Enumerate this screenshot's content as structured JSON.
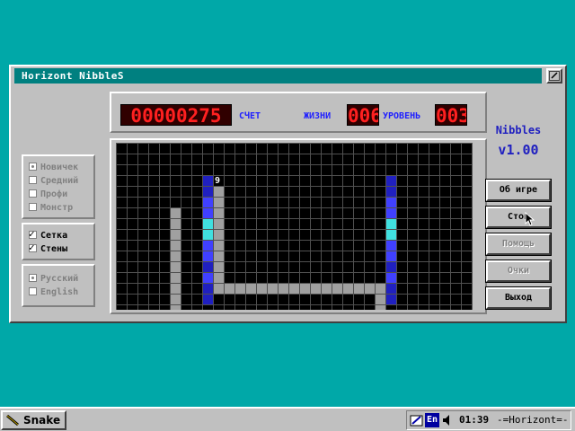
{
  "window": {
    "title": "Horizont NibbleS"
  },
  "options": {
    "difficulty": [
      {
        "label": "Новичек",
        "selected": true
      },
      {
        "label": "Средний",
        "selected": false
      },
      {
        "label": "Профи",
        "selected": false
      },
      {
        "label": "Монстр",
        "selected": false
      }
    ],
    "toggles": [
      {
        "label": "Сетка",
        "checked": true
      },
      {
        "label": "Стены",
        "checked": true
      }
    ],
    "language": [
      {
        "label": "Русский",
        "selected": true
      },
      {
        "label": "English",
        "selected": false
      }
    ]
  },
  "scoreboard": {
    "score": "00000275",
    "score_label": "СЧЕТ",
    "lives_label": "ЖИЗНИ",
    "lives": "006",
    "level_label": "УРОВЕНЬ",
    "level": "003"
  },
  "board": {
    "cols": 33,
    "rows": 23,
    "grid_visible": true,
    "food_number": "9",
    "food_cell": [
      8,
      3
    ],
    "walls": [
      [
        [
          8,
          3
        ],
        [
          8,
          14
        ]
      ],
      [
        [
          25,
          3
        ],
        [
          25,
          14
        ]
      ]
    ],
    "snake1_color": "#a0a0a0",
    "snake2_color": "#a0a0a0",
    "colors": {
      "wall_dark": "#2020c0",
      "wall_light": "#4040ff",
      "wall_cyan": "#40e0e0",
      "grid": "#505050",
      "bg": "#000000"
    }
  },
  "brand": {
    "name": "Nibbles",
    "version": "v1.00"
  },
  "buttons": [
    {
      "label": "Об игре",
      "enabled": true
    },
    {
      "label": "Стоп",
      "enabled": true
    },
    {
      "label": "Помощь",
      "enabled": false
    },
    {
      "label": "Очки",
      "enabled": false
    },
    {
      "label": "Выход",
      "enabled": true
    }
  ],
  "taskbar": {
    "task_label": "Snake",
    "lang_indicator": "En",
    "time": "01:39",
    "host": "-=Horizont=-"
  }
}
